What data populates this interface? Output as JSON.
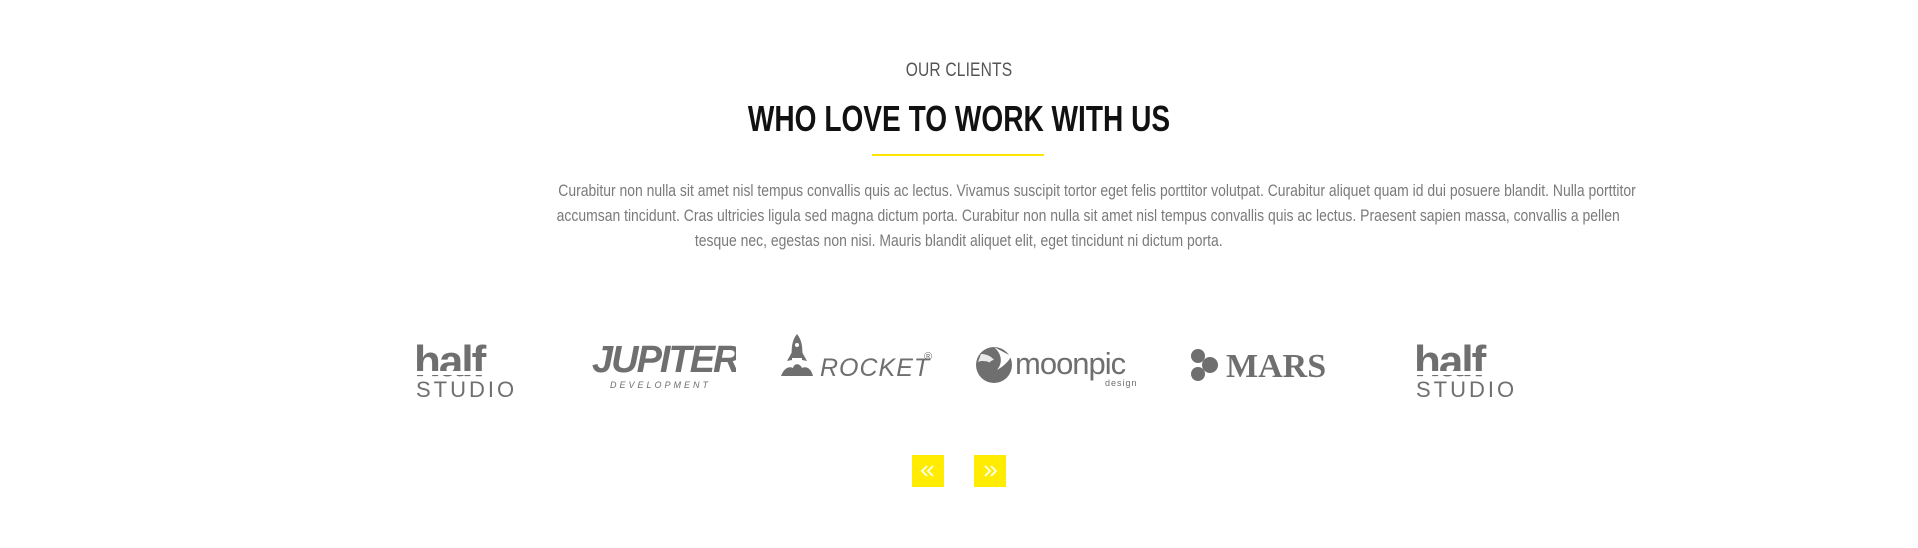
{
  "section": {
    "eyebrow": "OUR CLIENTS",
    "title": "WHO LOVE TO WORK WITH US",
    "description_lines": [
      "Curabitur non nulla sit amet nisl tempus convallis quis ac lectus. Vivamus suscipit tortor eget felis porttitor volutpat. Curabitur aliquet quam id dui posuere blandit. Nulla porttitor",
      "accumsan tincidunt. Cras ultricies ligula sed magna dictum porta. Curabitur non nulla sit amet nisl tempus convallis quis ac lectus. Praesent sapien massa, convallis a pellen",
      "tesque nec, egestas non nisi. Mauris blandit aliquet elit, eget tincidunt ni dictum porta."
    ]
  },
  "logos": [
    {
      "name": "half STUDIO",
      "text_top": "half",
      "text_bottom": "STUDIO"
    },
    {
      "name": "JUPITER DEVELOPMENT",
      "text_top": "JUPITER",
      "text_bottom": "DEVELOPMENT"
    },
    {
      "name": "ROCKET",
      "text_top": "ROCKET",
      "text_bottom": "®"
    },
    {
      "name": "moonpic design",
      "text_top": "moonpic",
      "text_bottom": "design"
    },
    {
      "name": "MARS",
      "text_top": "MARS",
      "text_bottom": ""
    },
    {
      "name": "half STUDIO",
      "text_top": "half",
      "text_bottom": "STUDIO"
    }
  ],
  "carousel": {
    "prev_icon": "double-chevron-left-icon",
    "next_icon": "double-chevron-right-icon"
  },
  "colors": {
    "accent": "#ffe600",
    "nav_bg": "#ffec00",
    "logo_gray": "#6f6f6f",
    "heading": "#111111",
    "body_text": "#7a7a7a"
  }
}
